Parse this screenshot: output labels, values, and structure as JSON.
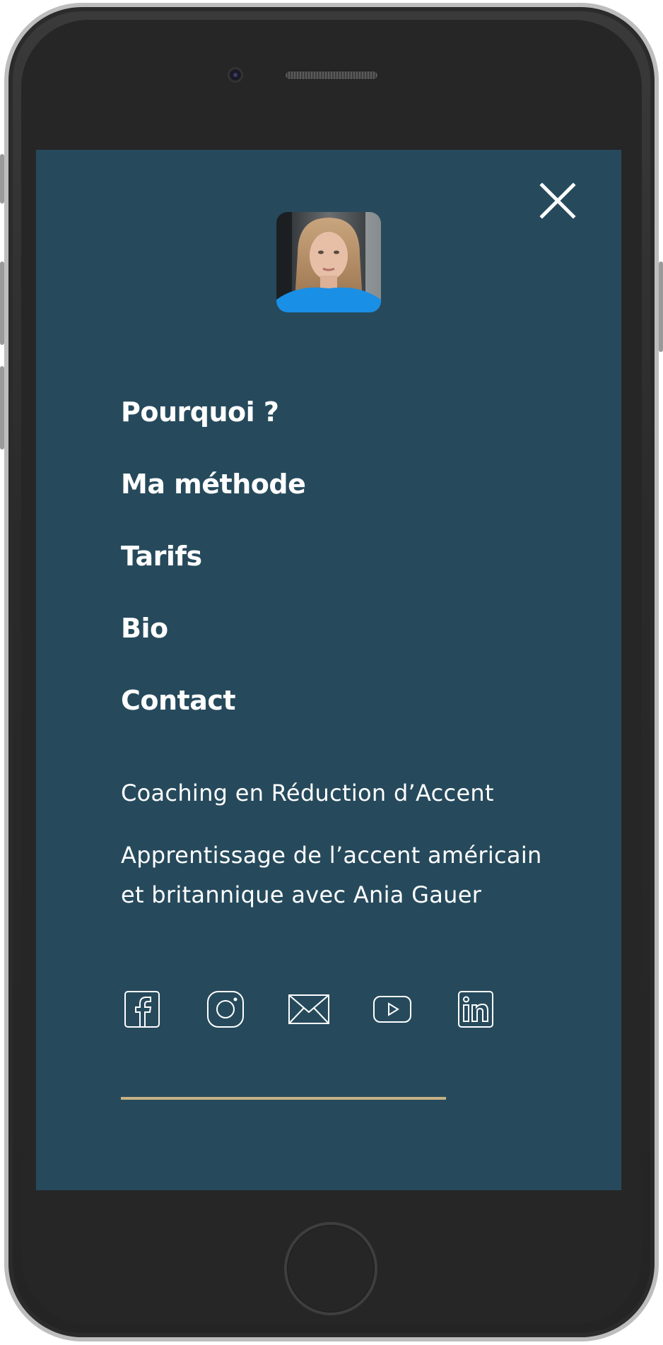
{
  "menu": {
    "items": [
      {
        "label": "Pourquoi ?"
      },
      {
        "label": "Ma méthode"
      },
      {
        "label": "Tarifs"
      },
      {
        "label": "Bio"
      },
      {
        "label": "Contact"
      }
    ]
  },
  "info": {
    "tagline": "Coaching en Réduction d’Accent",
    "description": "Apprentissage de l’accent américain et britannique avec Ania Gauer"
  },
  "social": {
    "icons": [
      "facebook-icon",
      "instagram-icon",
      "email-icon",
      "youtube-icon",
      "linkedin-icon"
    ]
  },
  "colors": {
    "screen_background": "#264a5c",
    "text": "#ffffff",
    "divider": "#c6b185",
    "device_frame": "#262626"
  }
}
